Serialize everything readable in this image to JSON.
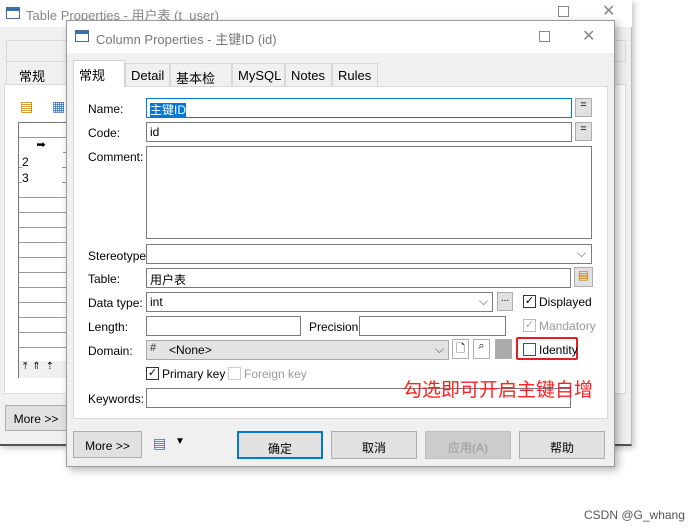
{
  "background_window": {
    "title": "Table Properties - 用户表 (t_user)",
    "tab": "常规",
    "rows": [
      "2",
      "3"
    ],
    "more_label": "More >>"
  },
  "dialog": {
    "title": "Column Properties - 主键ID (id)",
    "tabs": [
      "常规",
      "Detail",
      "基本检查",
      "MySQL",
      "Notes",
      "Rules"
    ],
    "fields": {
      "name_label": "Name:",
      "name_value": "主键ID",
      "code_label": "Code:",
      "code_value": "id",
      "comment_label": "Comment:",
      "comment_value": "",
      "stereotype_label": "Stereotype:",
      "stereotype_value": "",
      "table_label": "Table:",
      "table_value": "用户表",
      "datatype_label": "Data type:",
      "datatype_value": "int",
      "ellipsis": "...",
      "length_label": "Length:",
      "length_value": "",
      "precision_label": "Precision:",
      "precision_value": "",
      "domain_label": "Domain:",
      "domain_value": "<None>",
      "keywords_label": "Keywords:",
      "keywords_value": "",
      "eq": "="
    },
    "checkboxes": {
      "displayed": {
        "label": "Displayed",
        "checked": true
      },
      "mandatory": {
        "label": "Mandatory",
        "checked": true,
        "disabled": true
      },
      "identity": {
        "label": "Identity",
        "checked": false
      },
      "primary_key": {
        "label": "Primary key",
        "checked": true
      },
      "foreign_key": {
        "label": "Foreign key",
        "checked": false,
        "disabled": true
      }
    },
    "buttons": {
      "more": "More >>",
      "ok": "确定",
      "cancel": "取消",
      "apply": "应用(A)",
      "help": "帮助"
    }
  },
  "annotation": {
    "text": "勾选即可开启主键自增",
    "color": "#ff2020"
  },
  "watermark": "CSDN @G_whang",
  "colors": {
    "focus": "#0078d7",
    "highlight": "#0078d7",
    "annotation_box": "#e02020"
  }
}
